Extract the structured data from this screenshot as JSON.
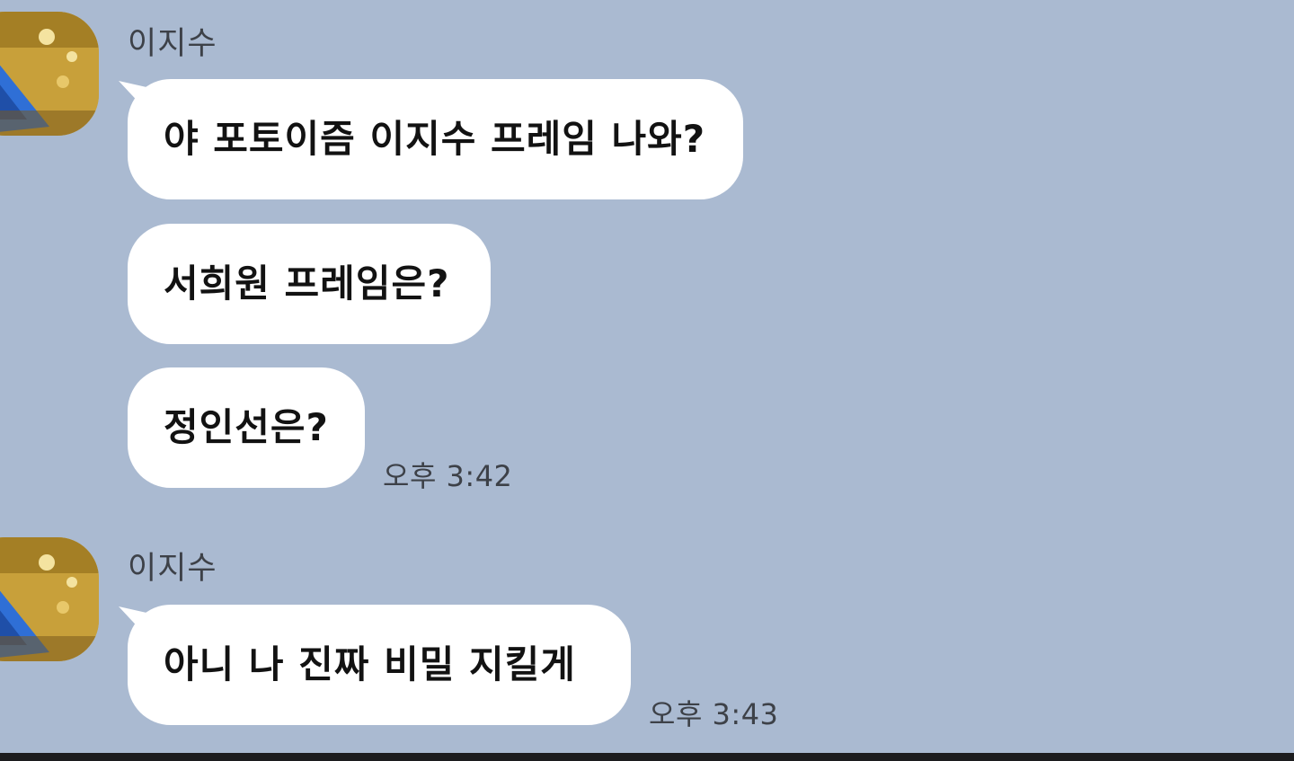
{
  "groups": [
    {
      "sender": "이지수",
      "messages": [
        "야 포토이즘 이지수 프레임 나와?",
        "서희원 프레임은?",
        "정인선은?"
      ],
      "time": "오후 3:42"
    },
    {
      "sender": "이지수",
      "messages": [
        "아니 나 진짜 비밀 지킬게"
      ],
      "time": "오후 3:43"
    }
  ],
  "colors": {
    "background": "#aabad1",
    "bubble": "#ffffff",
    "bottom_bar": "#1c1c1e"
  }
}
